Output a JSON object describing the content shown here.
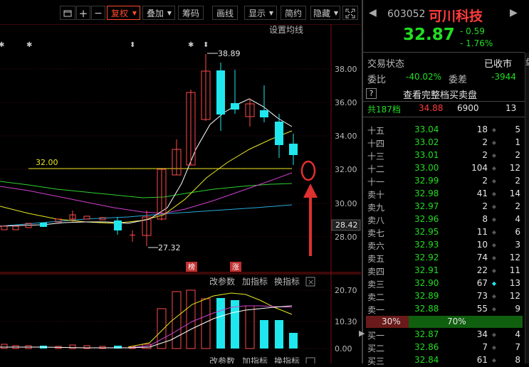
{
  "toolbar": {
    "plus": "+",
    "minus": "−",
    "fuquan": "复权",
    "diejia": "叠加",
    "chouma": "筹码",
    "huaxian": "画线",
    "xianshi": "显示",
    "jianyue": "简约",
    "yincang": "隐藏"
  },
  "main_chart": {
    "settings_label": "设置均线",
    "high_label": "38.89",
    "low_label": "27.32",
    "line_label": "32.00",
    "price_axis": [
      "38.00",
      "36.00",
      "34.00",
      "32.00",
      "30.00",
      "28.42",
      "28.00"
    ],
    "tags": [
      "榜",
      "涨"
    ]
  },
  "sub_chart": {
    "btn_params": "改参数",
    "btn_add": "加指标",
    "btn_switch": "换指标",
    "close": "×",
    "axis": [
      "20.70",
      "10.30",
      "0.00"
    ]
  },
  "quote": {
    "code": "603052",
    "name": "可川科技",
    "price": "32.87",
    "change": "- 0.59",
    "change_pct": "- 1.76%",
    "status_label": "交易状态",
    "status_value": "已收市",
    "weibi_label": "委比",
    "weibi_value": "-40.02%",
    "weicha_label": "委差",
    "weicha_value": "-3944",
    "full_book_link": "查看完整档买卖盘",
    "summary_label": "共187档",
    "summary_price": "34.88",
    "summary_vol": "6900",
    "summary_cnt": "13",
    "ratio_sell": "30%",
    "ratio_buy": "70%",
    "side_tab": "盘"
  },
  "order_book": {
    "asks": [
      {
        "label": "十五",
        "price": "33.04",
        "vol": "18",
        "cnt": "5"
      },
      {
        "label": "十四",
        "price": "33.02",
        "vol": "2",
        "cnt": "1"
      },
      {
        "label": "十三",
        "price": "33.01",
        "vol": "2",
        "cnt": "2"
      },
      {
        "label": "十二",
        "price": "33.00",
        "vol": "104",
        "cnt": "12"
      },
      {
        "label": "十一",
        "price": "32.99",
        "vol": "2",
        "cnt": "2"
      },
      {
        "label": "卖十",
        "price": "32.98",
        "vol": "41",
        "cnt": "14"
      },
      {
        "label": "卖九",
        "price": "32.97",
        "vol": "2",
        "cnt": "2"
      },
      {
        "label": "卖八",
        "price": "32.96",
        "vol": "8",
        "cnt": "4"
      },
      {
        "label": "卖七",
        "price": "32.95",
        "vol": "11",
        "cnt": "6"
      },
      {
        "label": "卖六",
        "price": "32.93",
        "vol": "10",
        "cnt": "3"
      },
      {
        "label": "卖五",
        "price": "32.92",
        "vol": "74",
        "cnt": "12"
      },
      {
        "label": "卖四",
        "price": "32.91",
        "vol": "22",
        "cnt": "11"
      },
      {
        "label": "卖三",
        "price": "32.90",
        "vol": "67",
        "cnt": "13"
      },
      {
        "label": "卖二",
        "price": "32.89",
        "vol": "73",
        "cnt": "12"
      },
      {
        "label": "卖一",
        "price": "32.88",
        "vol": "55",
        "cnt": "9"
      }
    ],
    "bids": [
      {
        "label": "买一",
        "price": "32.87",
        "vol": "34",
        "cnt": "4"
      },
      {
        "label": "买二",
        "price": "32.86",
        "vol": "7",
        "cnt": "7"
      },
      {
        "label": "买三",
        "price": "32.84",
        "vol": "61",
        "cnt": "8"
      }
    ]
  },
  "colors": {
    "up": "#ff3b3b",
    "down": "#1ee8ee",
    "price_green": "#22dd22",
    "accent_red": "#ff4a2a"
  }
}
